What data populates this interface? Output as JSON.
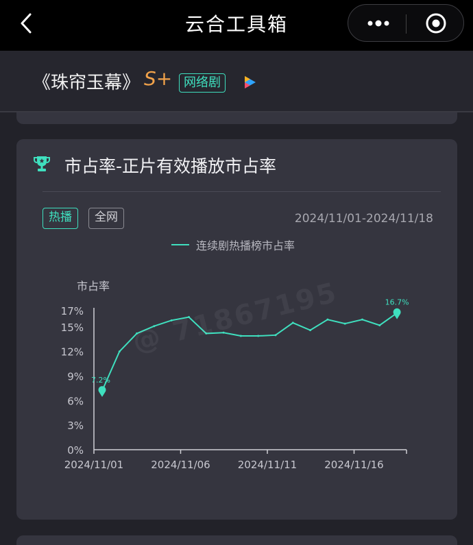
{
  "topbar": {
    "title": "云合工具箱"
  },
  "show": {
    "title": "《珠帘玉幕》",
    "grade": "S+",
    "genre": "网络剧"
  },
  "card": {
    "title": "市占率-正片有效播放市占率",
    "tabs": [
      {
        "label": "热播",
        "active": true
      },
      {
        "label": "全网",
        "active": false
      }
    ],
    "date_range": "2024/11/01-2024/11/18"
  },
  "watermark": "@ 71867195",
  "colors": {
    "accent": "#3fe0bf",
    "grade": "#f1a24a",
    "card_bg": "#35353f",
    "page_bg": "#222229"
  },
  "chart_data": {
    "type": "line",
    "ylabel": "市占率",
    "xlabel": "",
    "yticks": [
      "17%",
      "15%",
      "12%",
      "9%",
      "6%",
      "3%",
      "0%"
    ],
    "ytick_values": [
      17,
      15,
      12,
      9,
      6,
      3,
      0
    ],
    "ylim": [
      0,
      17
    ],
    "xticks": [
      "2024/11/01",
      "2024/11/06",
      "2024/11/11",
      "2024/11/16"
    ],
    "xtick_index": [
      0,
      5,
      10,
      15
    ],
    "x": [
      "2024/11/01",
      "2024/11/02",
      "2024/11/03",
      "2024/11/04",
      "2024/11/05",
      "2024/11/06",
      "2024/11/07",
      "2024/11/08",
      "2024/11/09",
      "2024/11/10",
      "2024/11/11",
      "2024/11/12",
      "2024/11/13",
      "2024/11/14",
      "2024/11/15",
      "2024/11/16",
      "2024/11/17",
      "2024/11/18"
    ],
    "series": [
      {
        "name": "连续剧热播榜市占率",
        "values": [
          7.2,
          12.0,
          14.2,
          15.1,
          15.8,
          16.2,
          14.2,
          14.3,
          13.9,
          13.9,
          14.0,
          15.5,
          14.6,
          15.9,
          15.4,
          15.9,
          15.2,
          16.7
        ],
        "data_labels": [
          {
            "index": 0,
            "label": "7.2%"
          },
          {
            "index": 17,
            "label": "16.7%"
          }
        ]
      }
    ],
    "grid": false,
    "legend": "top-center"
  }
}
